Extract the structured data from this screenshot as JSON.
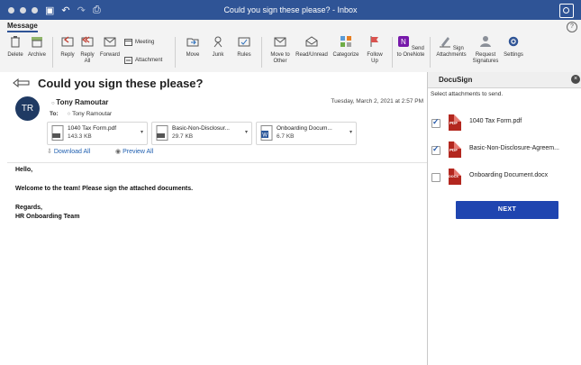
{
  "window": {
    "title": "Could you sign these please? - Inbox"
  },
  "ribbon": {
    "tab": "Message",
    "buttons": {
      "delete": "Delete",
      "archive": "Archive",
      "reply": "Reply",
      "reply_all": "Reply All",
      "forward": "Forward",
      "meeting": "Meeting",
      "attachment": "Attachment",
      "move": "Move",
      "junk": "Junk",
      "rules": "Rules",
      "move_to_other": "Move to Other",
      "read_unread": "Read/Unread",
      "categorize": "Categorize",
      "follow_up": "Follow Up",
      "send_to_onenote": "Send to OneNote",
      "sign_attachments": "Sign Attachments",
      "request_signatures": "Request Signatures",
      "settings": "Settings"
    }
  },
  "message": {
    "subject": "Could you sign these please?",
    "avatar_initials": "TR",
    "sender": "Tony Ramoutar",
    "date": "Tuesday, March 2, 2021 at 2:57 PM",
    "to_label": "To:",
    "to_name": "Tony Ramoutar",
    "attachments": [
      {
        "name": "1040 Tax Form.pdf",
        "size": "143.3 KB",
        "type": "pdf"
      },
      {
        "name": "Basic-Non-Disclosur...",
        "size": "29.7 KB",
        "type": "pdf"
      },
      {
        "name": "Onboarding Docum...",
        "size": "6.7 KB",
        "type": "docx"
      }
    ],
    "download_all": "Download All",
    "preview_all": "Preview All",
    "body": {
      "greeting": "Hello,",
      "line1": "Welcome to the team! Please sign the attached documents.",
      "closing": "Regards,",
      "signature": "HR Onboarding Team"
    }
  },
  "docusign": {
    "title": "DocuSign",
    "instructions": "Select attachments to send.",
    "items": [
      {
        "name": "1040 Tax Form.pdf",
        "icon": "PDF",
        "checked": true
      },
      {
        "name": "Basic-Non-Disclosure-Agreem...",
        "icon": "PDF",
        "checked": true
      },
      {
        "name": "Onboarding Document.docx",
        "icon": "DOCX",
        "checked": false
      }
    ],
    "next_label": "NEXT"
  }
}
